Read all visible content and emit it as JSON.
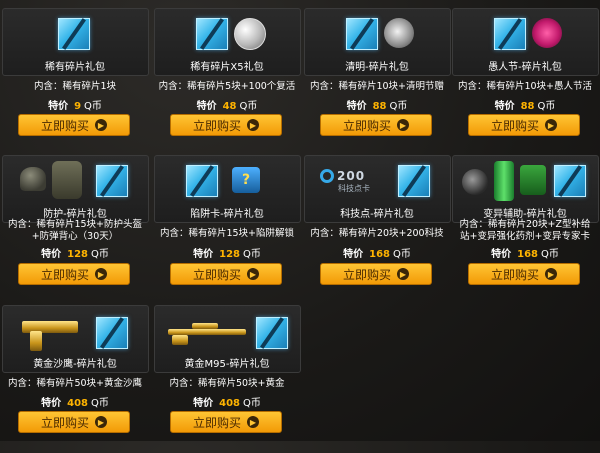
{
  "colors": {
    "accent": "#f6a714",
    "price": "#ffb400",
    "shard": "#35b5ea",
    "background": "#1b1a18"
  },
  "price_label": "特价",
  "currency": "Q币",
  "button_label": "立即购买",
  "icons": {
    "shard": "shard-icon",
    "arrow": "arrow-right-icon"
  },
  "packs": [
    {
      "name": "稀有碎片礼包",
      "contents": [
        "内含：稀有碎片1块"
      ],
      "price": "9",
      "thumb": "none"
    },
    {
      "name": "稀有碎片X5礼包",
      "contents": [
        "内含：稀有碎片5块+100个复活"
      ],
      "price": "48",
      "thumb": "silver-coin-icon"
    },
    {
      "name": "清明-碎片礼包",
      "contents": [
        "内含：稀有碎片10块+清明节赠"
      ],
      "price": "88",
      "thumb": "qingming-stamp-icon"
    },
    {
      "name": "愚人节-碎片礼包",
      "contents": [
        "内含：稀有碎片10块+愚人节活"
      ],
      "price": "88",
      "thumb": "flower-icon"
    },
    {
      "name": "防护-碎片礼包",
      "contents": [
        "内含：稀有碎片15块+防护头盔",
        "+防弹背心（30天）"
      ],
      "price": "128",
      "thumb": "helmet-vest-icon"
    },
    {
      "name": "陷阱卡-碎片礼包",
      "contents": [
        "内含：稀有碎片15块+陷阱解锁"
      ],
      "price": "128",
      "thumb": "trap-card-icon"
    },
    {
      "name": "科技点-碎片礼包",
      "contents": [
        "内含：稀有碎片20块+200科技"
      ],
      "price": "168",
      "thumb": "tech-points-card-icon",
      "tech_card": {
        "title": "200",
        "subtitle": "科技点卡"
      }
    },
    {
      "name": "变异辅助-碎片礼包",
      "contents": [
        "内含：稀有碎片20块+Z型补给",
        "站+变异强化药剂+变异专家卡"
      ],
      "price": "168",
      "thumb": "mutant-support-icon"
    },
    {
      "name": "黄金沙鹰-碎片礼包",
      "contents": [
        "内含：稀有碎片50块+黄金沙鹰"
      ],
      "price": "408",
      "thumb": "golden-desert-eagle-icon"
    },
    {
      "name": "黄金M95-碎片礼包",
      "contents": [
        "内含：稀有碎片50块+黄金"
      ],
      "price": "408",
      "thumb": "golden-m95-icon"
    }
  ]
}
